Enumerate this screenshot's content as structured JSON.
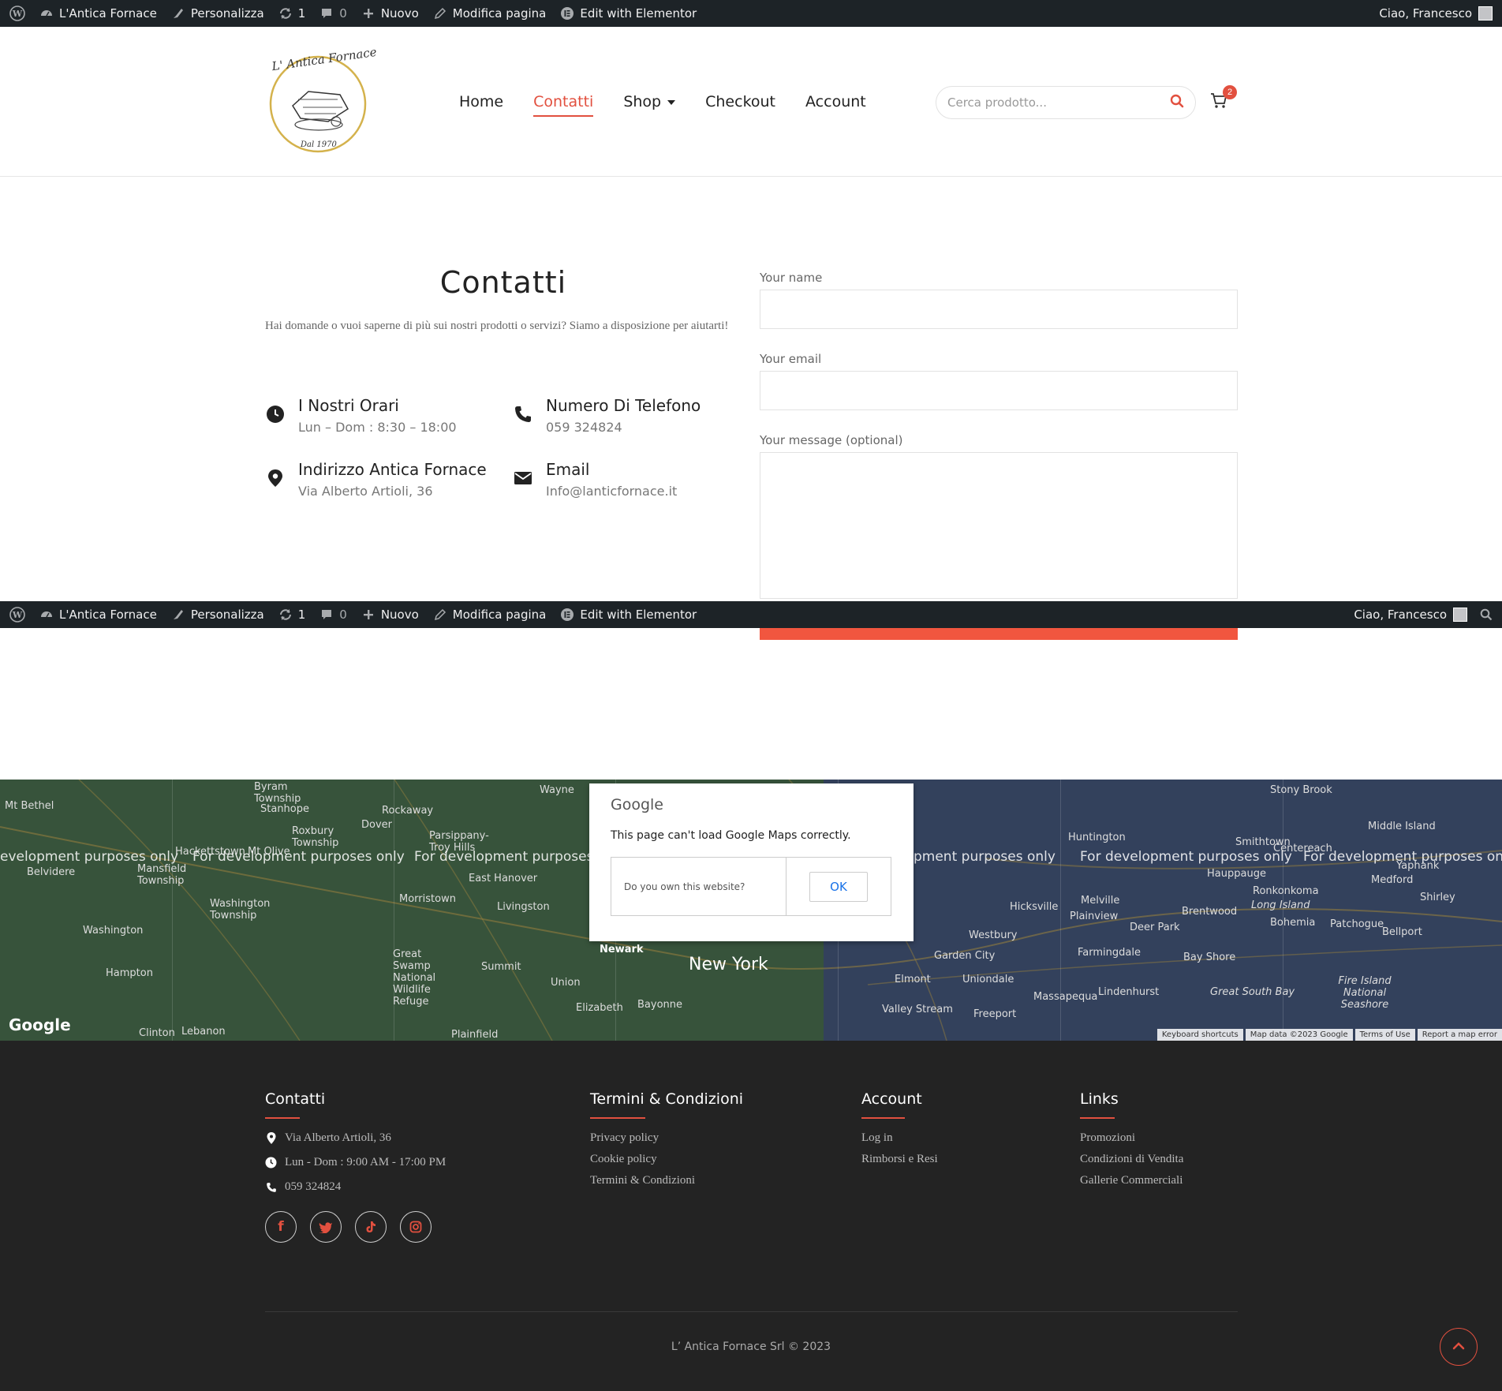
{
  "adminbar": {
    "site_name": "L'Antica Fornace",
    "customize": "Personalizza",
    "updates_count": "1",
    "comments_count": "0",
    "new": "Nuovo",
    "edit_page": "Modifica pagina",
    "edit_elementor": "Edit with Elementor",
    "greeting": "Ciao, Francesco"
  },
  "header": {
    "logo_text_top": "L' Antica Fornace",
    "logo_text_bottom": "Dal 1970",
    "nav": [
      "Home",
      "Contatti",
      "Shop",
      "Checkout",
      "Account"
    ],
    "active_nav": "Contatti",
    "search_placeholder": "Cerca prodotto...",
    "cart_count": "2"
  },
  "contact": {
    "title": "Contatti",
    "intro": "Hai domande o vuoi saperne di più sui nostri prodotti o servizi? Siamo a disposizione per aiutarti!",
    "hours_title": "I Nostri Orari",
    "hours_value": "Lun – Dom : 8:30 – 18:00",
    "phone_title": "Numero Di Telefono",
    "phone_value": "059 324824",
    "address_title": "Indirizzo Antica Fornace",
    "address_value": "Via Alberto Artioli, 36",
    "email_title": "Email",
    "email_value": "Info@lanticfornace.it"
  },
  "form": {
    "name_label": "Your name",
    "email_label": "Your email",
    "message_label": "Your message (optional)"
  },
  "map": {
    "dev_text": "For development purposes only",
    "dev_text_partial_left": "evelopment purposes only",
    "dev_text_partial_mid": "For development purposes on",
    "dev_text_partial_right": "pment purposes only",
    "city": "New York",
    "places": [
      "Mt Bethel",
      "Belvidere",
      "Mansfield Township",
      "Washington",
      "Hampton",
      "Clinton",
      "Byram Township",
      "Stanhope",
      "Roxbury Township",
      "Hackettstown",
      "Mt Olive",
      "Washington Township",
      "Lebanon",
      "Rockaway",
      "Dover",
      "Morristown",
      "Great Swamp National Wildlife Refuge",
      "Parsippany-Troy Hills",
      "East Hanover",
      "Livingston",
      "Summit",
      "Union",
      "Plainfield",
      "Wayne",
      "Newark",
      "Elizabeth",
      "Bayonne",
      "Elmont",
      "Valley Stream",
      "Freeport",
      "Garden City",
      "Uniondale",
      "Westbury",
      "Hicksville",
      "Plainview",
      "Farmingdale",
      "Massapequa",
      "Lindenhurst",
      "Melville",
      "Huntington",
      "Deer Park",
      "Brentwood",
      "Bay Shore",
      "Smithtown",
      "Hauppauge",
      "Ronkonkoma",
      "Long Island",
      "Bohemia",
      "Patchogue",
      "Centereach",
      "Stony Brook",
      "Middle Island",
      "Yaphank",
      "Medford",
      "Shirley",
      "Bellport",
      "Fire Island National Seashore",
      "Great South Bay"
    ],
    "dialog_logo": "Google",
    "dialog_message": "This page can't load Google Maps correctly.",
    "dialog_question": "Do you own this website?",
    "dialog_ok": "OK",
    "google_logo": "Google",
    "attributions": [
      "Keyboard shortcuts",
      "Map data ©2023 Google",
      "Terms of Use",
      "Report a map error"
    ]
  },
  "footer": {
    "col1_title": "Contatti",
    "col1_address": "Via Alberto Artioli, 36",
    "col1_hours": "Lun - Dom : 9:00 AM - 17:00 PM",
    "col1_phone": "059 324824",
    "col2_title": "Termini & Condizioni",
    "col2_links": [
      "Privacy policy",
      "Cookie policy",
      "Termini & Condizioni"
    ],
    "col3_title": "Account",
    "col3_links": [
      "Log in",
      "Rimborsi e Resi"
    ],
    "col4_title": "Links",
    "col4_links": [
      "Promozioni",
      "Condizioni di Vendita",
      "Gallerie Commerciali"
    ],
    "copyright": "L’ Antica Fornace Srl © 2023"
  },
  "colors": {
    "accent": "#e2503f",
    "adminbar": "#1d2327",
    "footer_bg": "#232323"
  }
}
